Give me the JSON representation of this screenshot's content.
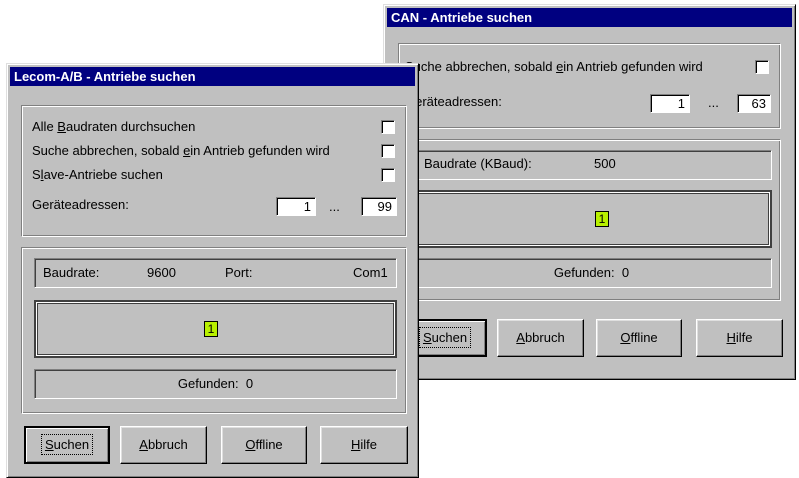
{
  "can": {
    "title": "CAN - Antriebe suchen",
    "abort_label_pre": "Suche abbrechen, sobald ",
    "abort_label_key": "e",
    "abort_label_post": "in Antrieb gefunden wird",
    "addr_label": "Geräteadressen:",
    "addr_from": "1",
    "addr_sep": "...",
    "addr_to": "63",
    "baud_label": "Baudrate (KBaud):",
    "baud_value": "500",
    "indicator": "1",
    "found_label": "Gefunden:",
    "found_value": "0",
    "buttons": {
      "search_key": "S",
      "search_rest": "uchen",
      "abort_key": "A",
      "abort_rest": "bbruch",
      "offline_key": "O",
      "offline_rest": "ffline",
      "help_key": "H",
      "help_rest": "ilfe"
    }
  },
  "lecom": {
    "title": "Lecom-A/B - Antriebe suchen",
    "all_baud_pre": "Alle ",
    "all_baud_key": "B",
    "all_baud_post": "audraten durchsuchen",
    "abort_label_pre": "Suche abbrechen, sobald ",
    "abort_label_key": "e",
    "abort_label_post": "in Antrieb gefunden wird",
    "slave_pre": "S",
    "slave_key": "l",
    "slave_post": "ave-Antriebe suchen",
    "addr_label": "Geräteadressen:",
    "addr_from": "1",
    "addr_sep": "...",
    "addr_to": "99",
    "baud_label": "Baudrate:",
    "baud_value": "9600",
    "port_label": "Port:",
    "port_value": "Com1",
    "indicator": "1",
    "found_label": "Gefunden:",
    "found_value": "0",
    "buttons": {
      "search_key": "S",
      "search_rest": "uchen",
      "abort_key": "A",
      "abort_rest": "bbruch",
      "offline_key": "O",
      "offline_rest": "ffline",
      "help_key": "H",
      "help_rest": "ilfe"
    }
  }
}
